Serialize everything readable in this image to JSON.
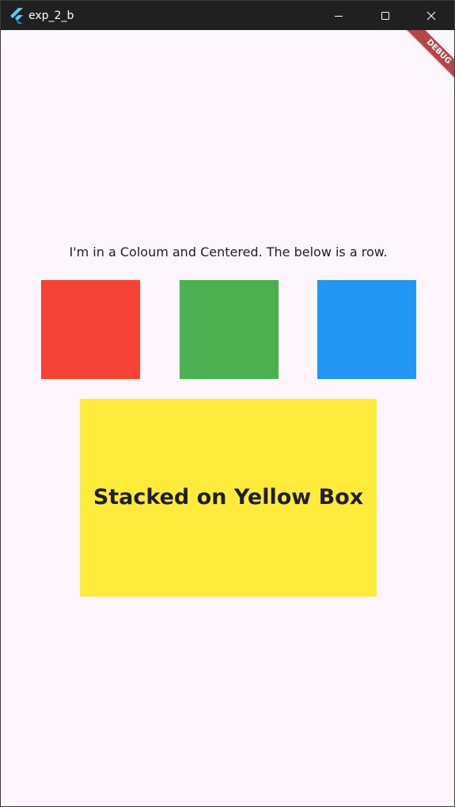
{
  "window": {
    "title": "exp_2_b",
    "icon": "flutter-icon",
    "controls": {
      "minimize": "minimize-icon",
      "maximize": "maximize-icon",
      "close": "close-icon"
    }
  },
  "banner": {
    "label": "DEBUG"
  },
  "main": {
    "caption": "I'm in a Coloum and Centered. The below is a row.",
    "row": {
      "boxes": [
        {
          "color": "#f44336"
        },
        {
          "color": "#4caf50"
        },
        {
          "color": "#2196f3"
        }
      ]
    },
    "stack": {
      "color": "#ffeb3b",
      "label": "Stacked on Yellow Box"
    }
  }
}
